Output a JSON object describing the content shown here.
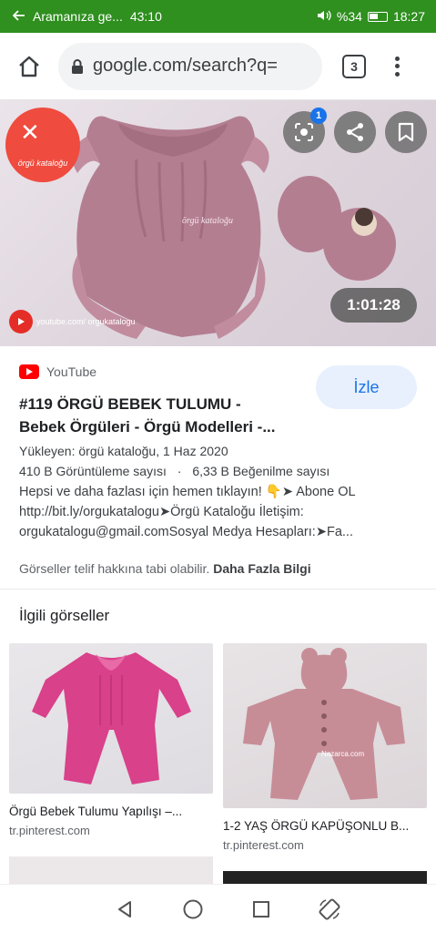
{
  "status_bar": {
    "back_text": "Aramanıza ge...",
    "call_time": "43:10",
    "battery": "%34",
    "time": "18:27"
  },
  "browser": {
    "url": "google.com/search?q=",
    "tab_count": "3"
  },
  "hero": {
    "logo_text": "örgü kataloğu",
    "lens_badge": "1",
    "duration": "1:01:28",
    "watermark": "youtube.com/ orgukatalogu"
  },
  "result": {
    "source": "YouTube",
    "watch_label": "İzle",
    "title_line1": "#119 ÖRGÜ BEBEK TULUMU -",
    "title_line2": "Bebek Örgüleri - Örgü Modelleri -...",
    "uploader": "Yükleyen: örgü kataloğu, 1 Haz 2020",
    "views": "410 B Görüntüleme sayısı",
    "separator": "·",
    "likes": "6,33 B Beğenilme sayısı",
    "desc_line1": "Hepsi ve daha fazlası için hemen tıklayın! 👇➤ Abone OL",
    "desc_line2": "http://bit.ly/orgukatalogu➤Örgü Kataloğu İletişim:",
    "desc_line3": "orgukatalogu@gmail.comSosyal Medya Hesapları:➤Fa...",
    "copyright": "Görseller telif hakkına tabi olabilir.",
    "more_info": "Daha Fazla Bilgi"
  },
  "related": {
    "heading": "İlgili görseller",
    "items": [
      {
        "caption": "Örgü Bebek Tulumu Yapılışı –...",
        "domain": "tr.pinterest.com"
      },
      {
        "caption": "1-2 YAŞ ÖRGÜ KAPÜŞONLU B...",
        "domain": "tr.pinterest.com",
        "watermark": "Nazarca.com"
      }
    ]
  },
  "colors": {
    "status_bar": "#2f8f1f",
    "link_blue": "#1a73e8",
    "youtube_red": "#ff0000",
    "garment_mauve": "#b07a8c",
    "garment_pink": "#d9418a"
  }
}
